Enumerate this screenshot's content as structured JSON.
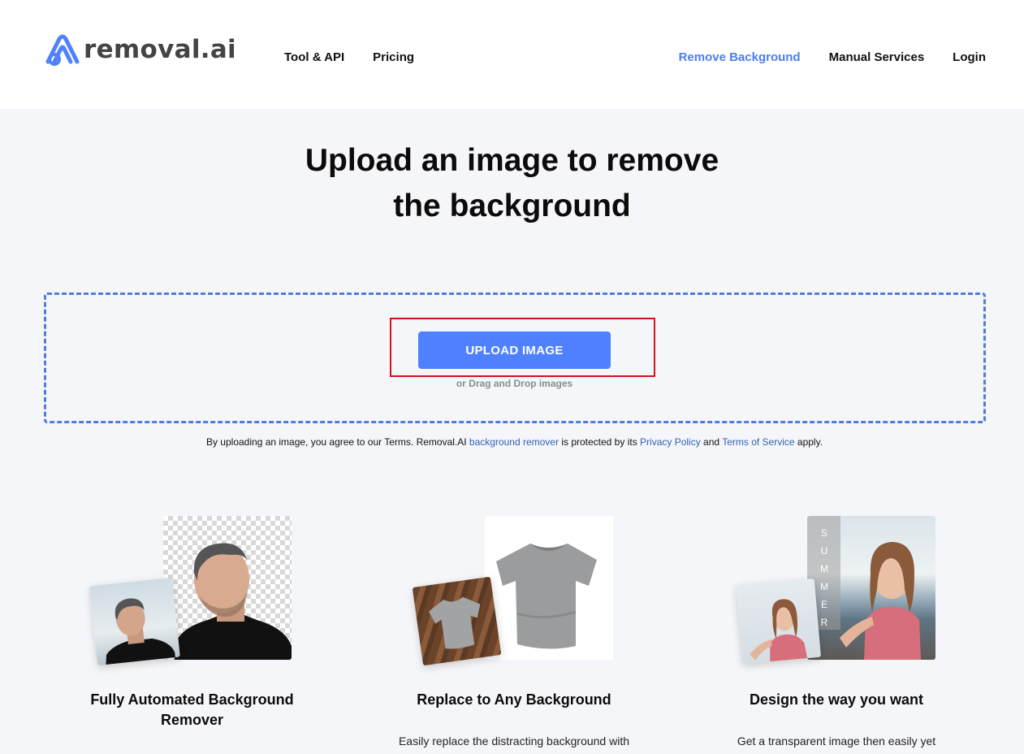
{
  "header": {
    "logo_text": "removal.ai",
    "nav_left": [
      "Tool & API",
      "Pricing"
    ],
    "nav_right": [
      {
        "label": "Remove Background",
        "active": true
      },
      {
        "label": "Manual Services",
        "active": false
      },
      {
        "label": "Login",
        "active": false
      }
    ]
  },
  "hero": {
    "title_line1": "Upload an image to remove",
    "title_line2": "the background"
  },
  "upload": {
    "button_label": "UPLOAD IMAGE",
    "drag_drop_text": "or Drag and Drop images"
  },
  "terms": {
    "prefix": "By uploading an image, you agree to our Terms. Removal.AI ",
    "link1": "background remover",
    "middle": " is protected by its ",
    "link2": "Privacy Policy",
    "and": " and ",
    "link3": "Terms of Service",
    "suffix": " apply."
  },
  "features": [
    {
      "title": "Fully Automated Background Remover",
      "description": ""
    },
    {
      "title": "Replace to Any Background",
      "description": "Easily replace the distracting background with"
    },
    {
      "title": "Design the way you want",
      "description": "Get a transparent image then easily yet"
    }
  ],
  "summer_letters": [
    "S",
    "U",
    "M",
    "M",
    "E",
    "R"
  ],
  "colors": {
    "accent": "#4f80ff",
    "active_nav": "#4c7ef0",
    "dropzone_border": "#4f7ed9",
    "highlight": "#d4121d",
    "link": "#2f5fb5",
    "page_bg": "#f5f6f9"
  }
}
